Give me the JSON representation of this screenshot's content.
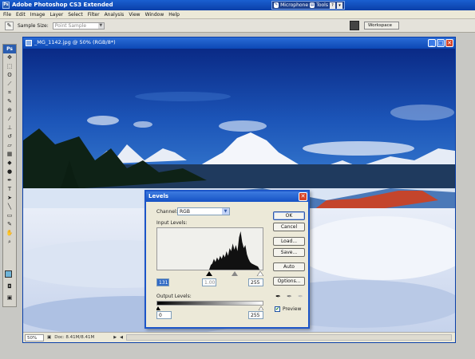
{
  "app": {
    "title": "Adobe Photoshop CS3 Extended",
    "ps_badge": "Ps"
  },
  "language_bar": {
    "microphone": "Microphone",
    "tools": "Tools",
    "help": "?"
  },
  "menu": [
    "File",
    "Edit",
    "Image",
    "Layer",
    "Select",
    "Filter",
    "Analysis",
    "View",
    "Window",
    "Help"
  ],
  "options_bar": {
    "sample_size_label": "Sample Size:",
    "sample_size_value": "Point Sample",
    "workspace_label": "Workspace"
  },
  "document": {
    "title": "_MG_1142.jpg @ 50% (RGB/8*)",
    "zoom": "50%",
    "doc_info": "Doc: 8.41M/8.41M"
  },
  "levels_dialog": {
    "title": "Levels",
    "channel_label": "Channel:",
    "channel_value": "RGB",
    "input_levels_label": "Input Levels:",
    "input_black": "131",
    "input_gamma": "1.00",
    "input_white": "255",
    "output_levels_label": "Output Levels:",
    "output_black": "0",
    "output_white": "255",
    "buttons": {
      "ok": "OK",
      "cancel": "Cancel",
      "load": "Load...",
      "save": "Save...",
      "auto": "Auto",
      "options": "Options..."
    },
    "preview_label": "Preview",
    "preview_checked": true
  },
  "colors": {
    "foreground": "#6fb4d8",
    "background": "#ffffff",
    "titlebar": "#0c48b5"
  }
}
